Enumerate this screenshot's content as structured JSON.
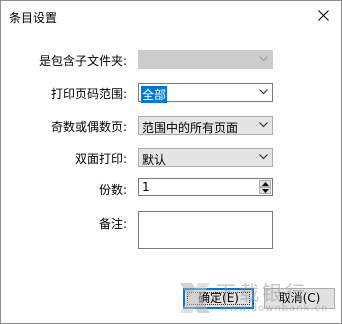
{
  "window": {
    "title": "条目设置"
  },
  "form": {
    "include_subfolders": {
      "label": "是包含子文件夹:",
      "value": ""
    },
    "print_range": {
      "label": "打印页码范围:",
      "value": "全部"
    },
    "odd_even": {
      "label": "奇数或偶数页:",
      "value": "范围中的所有页面"
    },
    "duplex": {
      "label": "双面打印:",
      "value": "默认"
    },
    "copies": {
      "label": "份数:",
      "value": "1"
    },
    "notes": {
      "label": "备注:",
      "value": ""
    }
  },
  "buttons": {
    "ok": "确定(E)",
    "cancel": "取消(C)"
  },
  "watermark": {
    "text": "下载银行",
    "url": "www.downbank.cn"
  },
  "colors": {
    "accent": "#0078d7",
    "button_bg": "#e1e1e1",
    "disabled_bg": "#cccccc"
  },
  "icons": {
    "close": "close-icon",
    "dropdown": "chevron-down-icon",
    "spin_up": "spin-up-icon",
    "spin_down": "spin-down-icon",
    "watermark_logo": "x-logo-icon"
  }
}
